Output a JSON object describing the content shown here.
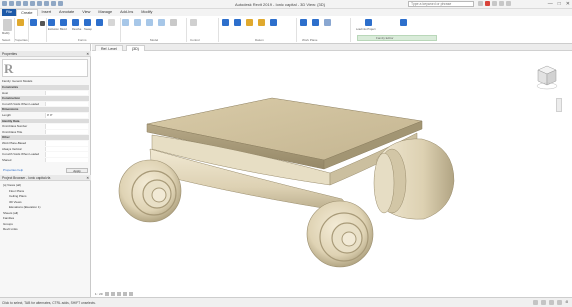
{
  "window": {
    "title": "Autodesk Revit 2019 - Ionic capital - 3D View: {3D}",
    "search_placeholder": "Type a keyword or phrase",
    "min": "—",
    "max": "□",
    "close": "✕"
  },
  "tabs": [
    "File",
    "Create",
    "Insert",
    "Annotate",
    "View",
    "Manage",
    "Add-Ins",
    "Modify"
  ],
  "ribbon": {
    "labels": [
      "Modify",
      "Paste",
      "Cut",
      "Join",
      "Properties",
      "Extrusion",
      "Blend",
      "Revolve",
      "Sweep",
      "Swept Blend",
      "Void Forms",
      "Model Line",
      "Component",
      "Model Text",
      "Opening",
      "Model Group",
      "Ref Line",
      "Ref Plane",
      "Set",
      "Show",
      "Viewer",
      "Load into Project",
      "Load into Project and Close"
    ],
    "panels": [
      "Select",
      "Properties",
      "Clipboard",
      "Geometry",
      "Forms",
      "Model",
      "Control",
      "Datum",
      "Work Plane",
      "Family Editor"
    ]
  },
  "properties": {
    "header": "Properties",
    "family_label": "Family: Generic Models",
    "rows": [
      {
        "k": "Constraints",
        "v": "",
        "head": true
      },
      {
        "k": "Host",
        "v": ""
      },
      {
        "k": "Construction",
        "v": "",
        "head": true
      },
      {
        "k": "Cut with Voids When Loaded",
        "v": ""
      },
      {
        "k": "Dimensions",
        "v": "",
        "head": true
      },
      {
        "k": "Length",
        "v": "0' 0\""
      },
      {
        "k": "Identity Data",
        "v": "",
        "head": true
      },
      {
        "k": "OmniClass Number",
        "v": ""
      },
      {
        "k": "OmniClass Title",
        "v": ""
      },
      {
        "k": "Other",
        "v": "",
        "head": true
      },
      {
        "k": "Work Plane-Based",
        "v": ""
      },
      {
        "k": "Always Vertical",
        "v": ""
      },
      {
        "k": "Cut with Voids When Loaded",
        "v": ""
      },
      {
        "k": "Shared",
        "v": ""
      }
    ],
    "apply": "Apply",
    "help": "Properties help"
  },
  "project_browser": {
    "header": "Project Browser - Ionic capital.rfa",
    "items": [
      "[o] Views (all)",
      "Floor Plans",
      "Ceiling Plans",
      "3D Views",
      "Elevations (Elevation 1)",
      "Sheets (all)",
      "Families",
      "Groups",
      "Revit Links"
    ]
  },
  "view": {
    "tab_label": "{3D}",
    "tab_alt": "Ref. Level"
  },
  "view_control": "1 : 20",
  "status": {
    "text": "Click to select, TAB for alternates, CTRL adds, SHIFT unselects.",
    "filter": ":0"
  },
  "colors": {
    "file_tab": "#1e5aa8",
    "model_light": "#efe6cf",
    "model_mid": "#d8ccad",
    "model_dark": "#a99b79"
  }
}
